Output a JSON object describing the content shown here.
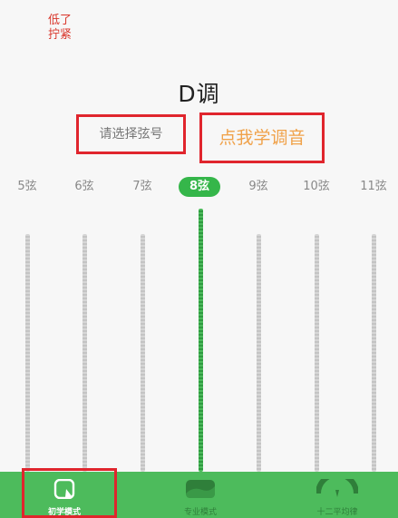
{
  "hint": {
    "line1": "低了",
    "line2": "拧紧"
  },
  "key_title": "D调",
  "select_string": {
    "label": "请选择弦号"
  },
  "learn_tuning": {
    "label": "点我学调音"
  },
  "strings": [
    {
      "label": "5弦",
      "active": false
    },
    {
      "label": "6弦",
      "active": false
    },
    {
      "label": "7弦",
      "active": false
    },
    {
      "label": "8弦",
      "active": true
    },
    {
      "label": "9弦",
      "active": false
    },
    {
      "label": "10弦",
      "active": false
    },
    {
      "label": "11弦",
      "active": false
    }
  ],
  "bottom_nav": [
    {
      "label": "初学模式",
      "icon": "beginner-mode-icon",
      "active": true
    },
    {
      "label": "专业模式",
      "icon": "pro-mode-icon",
      "active": false
    },
    {
      "label": "十二平均律",
      "icon": "twelve-tone-gauge-icon",
      "active": false
    }
  ],
  "colors": {
    "accent_green": "#4dbb5c",
    "highlight_red": "#e0252d",
    "hint_red": "#d9362b",
    "learn_orange": "#f0a24a"
  }
}
